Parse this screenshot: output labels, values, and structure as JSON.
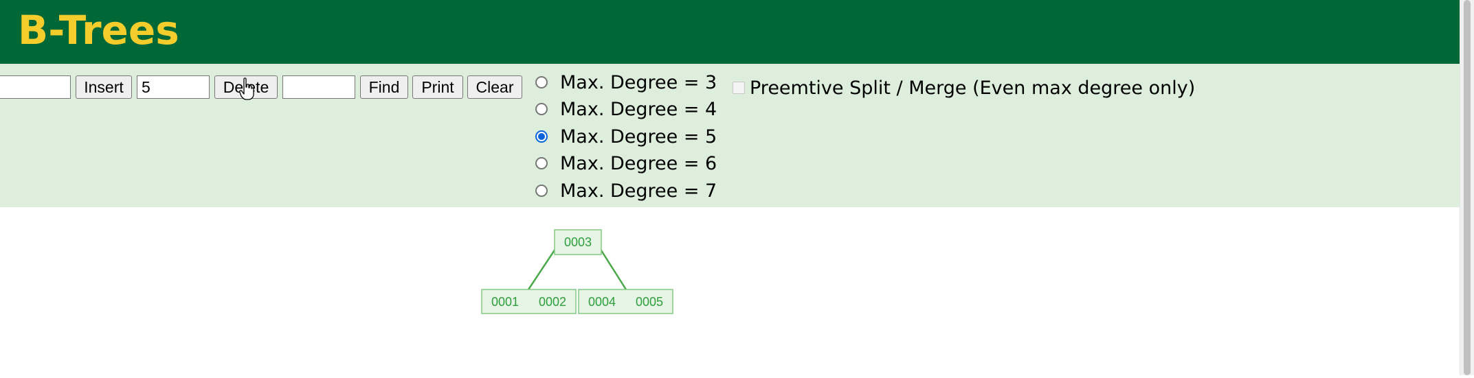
{
  "header": {
    "title": "B-Trees"
  },
  "controls": {
    "insert_input_value": "",
    "insert_label": "Insert",
    "delete_input_value": "5",
    "delete_label": "Delete",
    "find_input_value": "",
    "find_label": "Find",
    "print_label": "Print",
    "clear_label": "Clear",
    "degree_options": [
      {
        "label": "Max. Degree = 3",
        "checked": false
      },
      {
        "label": "Max. Degree = 4",
        "checked": false
      },
      {
        "label": "Max. Degree = 5",
        "checked": true
      },
      {
        "label": "Max. Degree = 6",
        "checked": false
      },
      {
        "label": "Max. Degree = 7",
        "checked": false
      }
    ],
    "preemptive_label": "Preemtive Split / Merge (Even max degree only)",
    "preemptive_checked": false
  },
  "tree": {
    "root": {
      "keys": [
        "0003"
      ]
    },
    "children": [
      {
        "keys": [
          "0001",
          "0002"
        ]
      },
      {
        "keys": [
          "0004",
          "0005"
        ]
      }
    ]
  },
  "colors": {
    "header_bg": "#006837",
    "title": "#f4cd2c",
    "controls_bg": "#ddeedc",
    "node_border": "#83c983",
    "node_fill": "#e6f5e6",
    "node_text": "#2d9e3a",
    "edge": "#4aa84a",
    "radio_accent": "#0a62d8"
  },
  "icons": {
    "cursor": "hand-pointer-icon"
  }
}
